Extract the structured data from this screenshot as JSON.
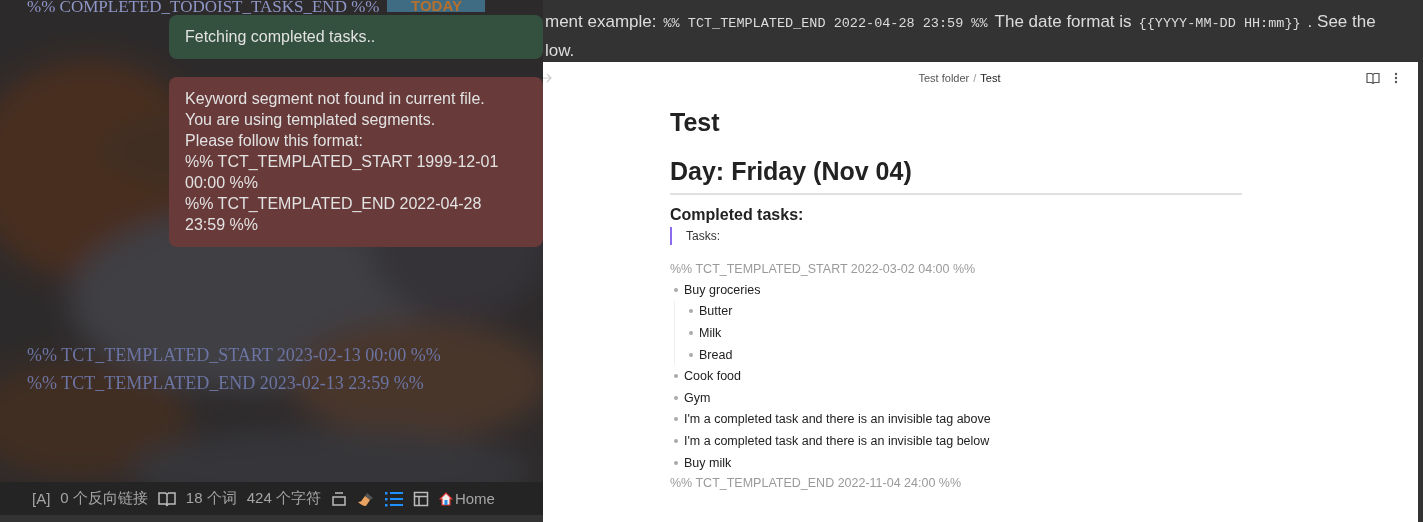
{
  "left_pane": {
    "top_line": "%% COMPLETED_TODOIST_TASKS_END %%",
    "today_button": "TODAY",
    "lines": [
      "%% TCT_TEMPLATED_START 2023-02-13 00:00 %%",
      "%% TCT_TEMPLATED_END 2023-02-13 23:59 %%"
    ]
  },
  "notices": [
    {
      "kind": "success",
      "text": "Fetching completed tasks.."
    },
    {
      "kind": "error",
      "text": "Keyword segment not found in current file.\nYou are using templated segments.\nPlease follow this format:\n%% TCT_TEMPLATED_START 1999-12-01 00:00 %%\n%% TCT_TEMPLATED_END 2022-04-28 23:59 %%"
    }
  ],
  "status_bar": {
    "mode": "[A]",
    "backlinks": "0 个反向链接",
    "words": "18 个词",
    "characters": "424 个字符",
    "home": "Home"
  },
  "readme": {
    "lines": [
      [
        {
          "kind": "text",
          "text": "ment example:"
        },
        {
          "kind": "code",
          "text": "%% TCT_TEMPLATED_END 2022-04-28 23:59 %%"
        },
        {
          "kind": "text",
          "text": "The date format is"
        },
        {
          "kind": "code",
          "text": "{{YYYY-MM-DD HH:mm}}"
        },
        {
          "kind": "text",
          "text": ". See the"
        }
      ],
      [
        {
          "kind": "text",
          "text": "low."
        }
      ]
    ]
  },
  "note": {
    "breadcrumb": [
      "Test folder",
      "Test"
    ],
    "separator": "/",
    "title": "Test",
    "heading": "Day: Friday (Nov 04)",
    "subheading": "Completed tasks:",
    "quote": "Tasks:",
    "start_marker": "%% TCT_TEMPLATED_START 2022-03-02 04:00 %%",
    "tasks": [
      {
        "text": "Buy groceries",
        "children": [
          {
            "text": "Butter"
          },
          {
            "text": "Milk"
          },
          {
            "text": "Bread"
          }
        ]
      },
      {
        "text": "Cook food"
      },
      {
        "text": "Gym"
      },
      {
        "text": "I'm a completed task and there is an invisible tag above"
      },
      {
        "text": "I'm a completed task and there is an invisible tag below"
      },
      {
        "text": "Buy milk"
      }
    ],
    "end_marker": "%% TCT_TEMPLATED_END 2022-11-04 24:00 %%"
  }
}
